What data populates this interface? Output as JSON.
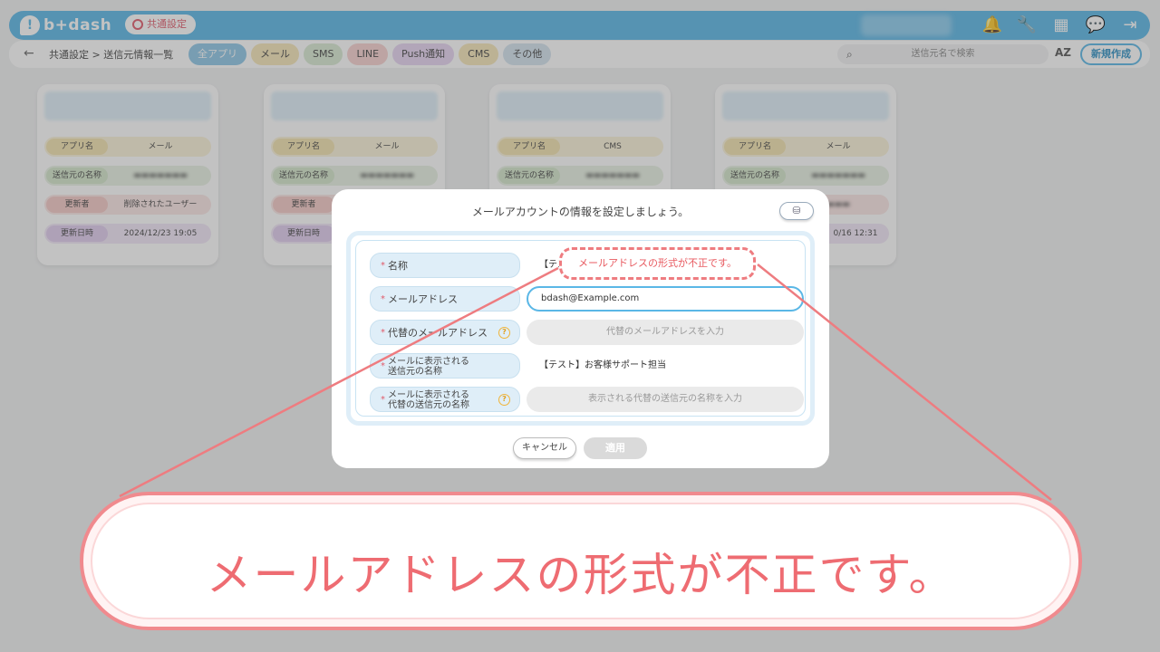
{
  "app": {
    "logo_text": "b+dash",
    "common_settings_badge": "共通設定",
    "top_icons": [
      "bell-icon",
      "wrench-icon",
      "grid-icon",
      "chat-icon",
      "logout-icon"
    ]
  },
  "subbar": {
    "breadcrumb": "共通設定 > 送信元情報一覧",
    "tabs": [
      {
        "label": "全アプリ",
        "color": "#8ec6e6"
      },
      {
        "label": "メール",
        "color": "#f6e7b8"
      },
      {
        "label": "SMS",
        "color": "#d9ead3"
      },
      {
        "label": "LINE",
        "color": "#f7d2d0"
      },
      {
        "label": "Push通知",
        "color": "#e7d5f2"
      },
      {
        "label": "CMS",
        "color": "#f6e7b8"
      },
      {
        "label": "その他",
        "color": "#d5e3ef"
      }
    ],
    "search_placeholder": "送信元名で検索",
    "sort_label": "AZ",
    "new_button": "新規作成"
  },
  "cards": [
    {
      "app_key": "アプリ名",
      "app_val": "メール",
      "sender_key": "送信元の名称",
      "updater_key": "更新者",
      "updater_val": "削除されたユーザー",
      "date_key": "更新日時",
      "date_val": "2024/12/23 19:05"
    },
    {
      "app_key": "アプリ名",
      "app_val": "メール",
      "sender_key": "送信元の名称",
      "updater_key": "更新者",
      "updater_val": "",
      "date_key": "更新日時",
      "date_val": ""
    },
    {
      "app_key": "アプリ名",
      "app_val": "CMS",
      "sender_key": "送信元の名称",
      "updater_key": "",
      "updater_val": "",
      "date_key": "",
      "date_val": ""
    },
    {
      "app_key": "アプリ名",
      "app_val": "メール",
      "sender_key": "送信元の名称",
      "updater_key": "",
      "updater_val": "",
      "date_key": "",
      "date_val": "0/16 12:31"
    }
  ],
  "modal": {
    "title": "メールアカウントの情報を設定しましょう。",
    "required_mark": "*",
    "fields": [
      {
        "label": "名称",
        "value": "【テス"
      },
      {
        "label": "メールアドレス",
        "value": "bdash@Example.com"
      },
      {
        "label": "代替のメールアドレス",
        "placeholder": "代替のメールアドレスを入力"
      },
      {
        "label_line1": "メールに表示される",
        "label_line2": "送信元の名称",
        "value": "【テスト】お客様サポート担当"
      },
      {
        "label_line1": "メールに表示される",
        "label_line2": "代替の送信元の名称",
        "placeholder": "表示される代替の送信元の名称を入力"
      }
    ],
    "cancel_button": "キャンセル",
    "apply_button": "適用"
  },
  "error": {
    "message": "メールアドレスの形式が不正です。",
    "color": "#ee6c72"
  }
}
